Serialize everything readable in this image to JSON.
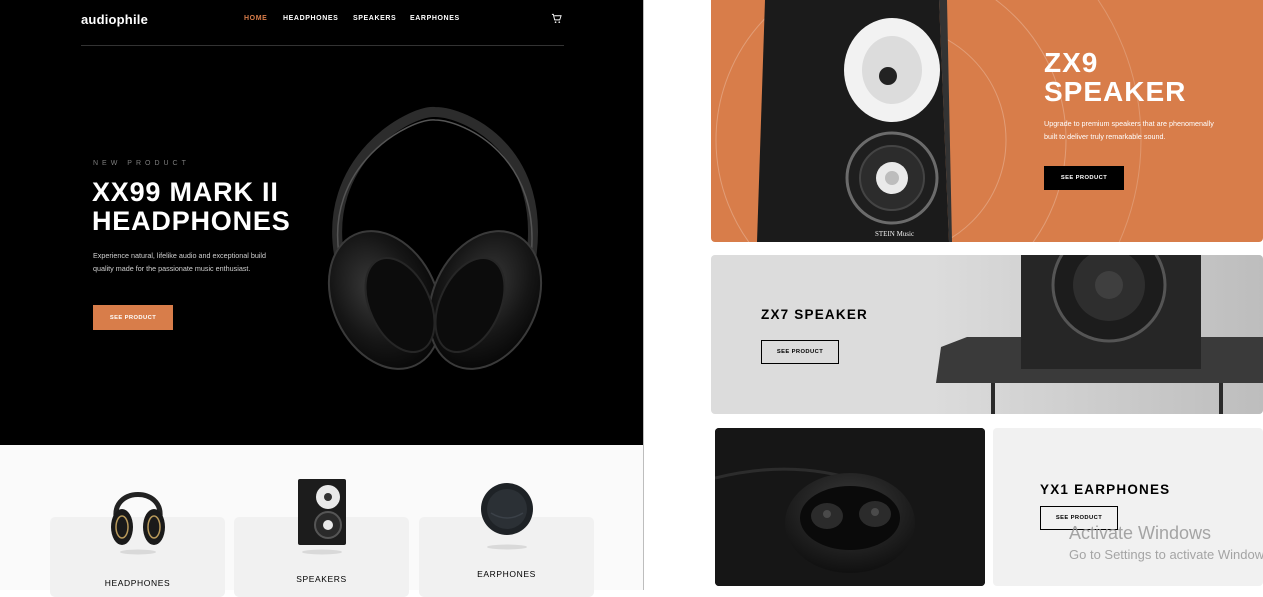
{
  "header": {
    "logo": "audiophile",
    "nav": [
      "HOME",
      "HEADPHONES",
      "SPEAKERS",
      "EARPHONES"
    ],
    "active_nav": "HOME",
    "cart_icon": "cart-icon"
  },
  "hero": {
    "overline": "NEW PRODUCT",
    "title_line1": "XX99 MARK II",
    "title_line2": "HEADPHONES",
    "description": "Experience natural, lifelike audio and exceptional build quality made for the passionate music enthusiast.",
    "button": "SEE PRODUCT"
  },
  "categories": [
    {
      "label": "HEADPHONES"
    },
    {
      "label": "SPEAKERS"
    },
    {
      "label": "EARPHONES"
    }
  ],
  "zx9": {
    "title_line1": "ZX9",
    "title_line2": "SPEAKER",
    "description": "Upgrade to premium speakers that are phenomenally built to deliver truly remarkable sound.",
    "button": "SEE PRODUCT",
    "speaker_brand": "STEIN Music"
  },
  "zx7": {
    "title": "ZX7 SPEAKER",
    "button": "SEE PRODUCT"
  },
  "yx1": {
    "title": "YX1 EARPHONES",
    "button": "SEE PRODUCT"
  },
  "watermark": {
    "line1": "Activate Windows",
    "line2": "Go to Settings to activate Windows."
  },
  "colors": {
    "accent": "#d87d4a",
    "dark": "#000000",
    "light_gray": "#f1f1f1"
  }
}
